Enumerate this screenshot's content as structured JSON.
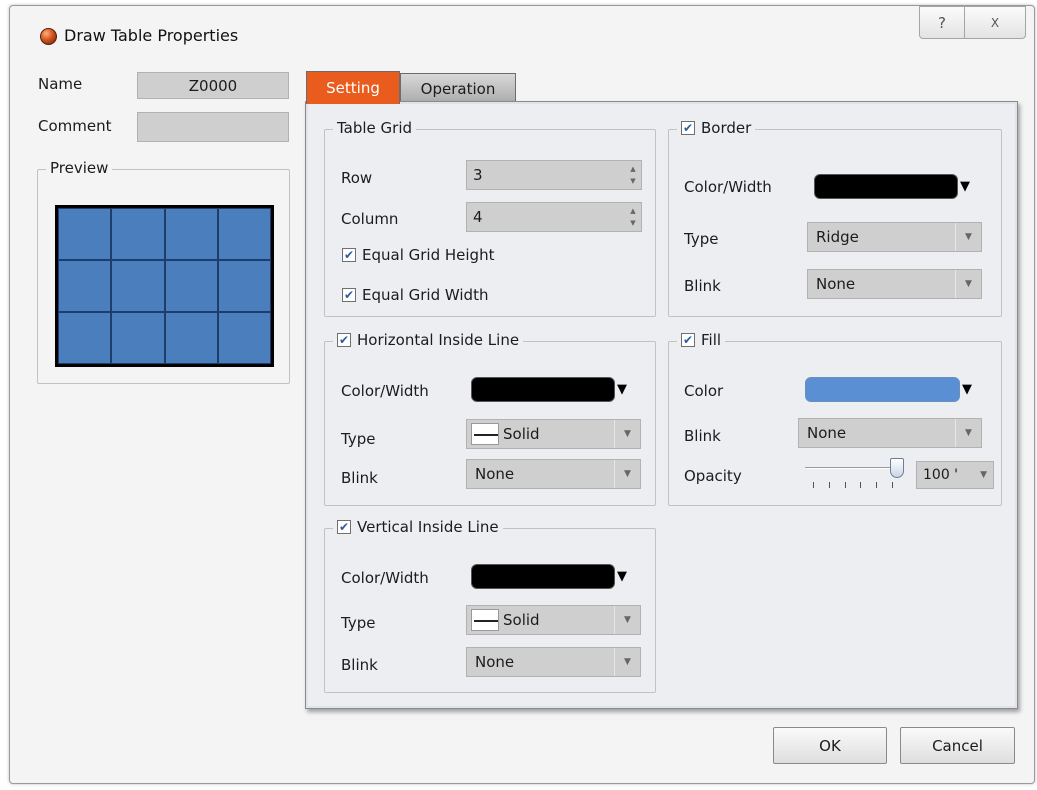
{
  "window": {
    "title": "Draw Table Properties",
    "help_glyph": "?",
    "close_glyph": "X"
  },
  "left": {
    "name_label": "Name",
    "name_value": "Z0000",
    "comment_label": "Comment",
    "comment_value": "",
    "preview_label": "Preview",
    "preview_rows": 3,
    "preview_cols": 4,
    "preview_fill_color": "#4f81bd"
  },
  "tabs": [
    {
      "label": "Setting",
      "active": true
    },
    {
      "label": "Operation",
      "active": false
    }
  ],
  "table_grid": {
    "title": "Table Grid",
    "row_label": "Row",
    "row_value": "3",
    "column_label": "Column",
    "column_value": "4",
    "equal_height_label": "Equal Grid Height",
    "equal_height_checked": true,
    "equal_width_label": "Equal Grid Width",
    "equal_width_checked": true
  },
  "border": {
    "title": "Border",
    "checked": true,
    "color_label": "Color/Width",
    "color": "#000000",
    "type_label": "Type",
    "type_value": "Ridge",
    "blink_label": "Blink",
    "blink_value": "None"
  },
  "horizontal_line": {
    "title": "Horizontal Inside Line",
    "checked": true,
    "color_label": "Color/Width",
    "color": "#000000",
    "type_label": "Type",
    "type_value": "Solid",
    "blink_label": "Blink",
    "blink_value": "None"
  },
  "fill": {
    "title": "Fill",
    "checked": true,
    "color_label": "Color",
    "color": "#5b8fd3",
    "blink_label": "Blink",
    "blink_value": "None",
    "opacity_label": "Opacity",
    "opacity_value": "100 '",
    "opacity_level": 1.0
  },
  "vertical_line": {
    "title": "Vertical Inside Line",
    "checked": true,
    "color_label": "Color/Width",
    "color": "#000000",
    "type_label": "Type",
    "type_value": "Solid",
    "blink_label": "Blink",
    "blink_value": "None"
  },
  "buttons": {
    "ok": "OK",
    "cancel": "Cancel"
  },
  "colors": {
    "active_tab": "#e95c1d",
    "panel_bg": "#eceef2",
    "check_mark": "#2b5d9c"
  }
}
